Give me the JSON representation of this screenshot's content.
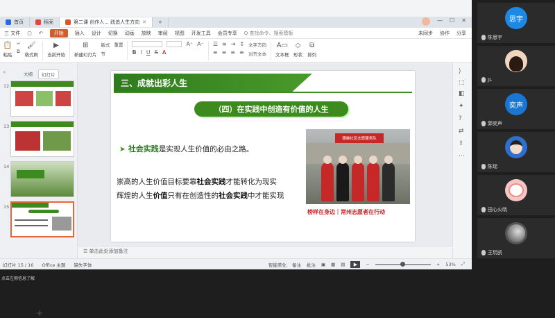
{
  "tabs": [
    {
      "label": "首页",
      "active": false
    },
    {
      "label": "稻壳",
      "active": false
    },
    {
      "label": "第二课 创作人... 践追人生方向",
      "active": true
    }
  ],
  "menu": {
    "items": [
      "三 文件",
      "开始",
      "插入",
      "设计",
      "切换",
      "动画",
      "放映",
      "审阅",
      "视图",
      "开发工具",
      "会员专享"
    ],
    "active": "开始",
    "search_placeholder": "Q 查找命令、搜索模板",
    "right": [
      "未同步",
      "协作",
      "分享"
    ]
  },
  "ribbon": {
    "paste": "粘贴",
    "format_painter": "格式刷",
    "from_current": "当前开始",
    "new_slide": "新建幻灯片",
    "layout": "版式",
    "section": "节",
    "reset": "重置",
    "textbox": "文本框",
    "shape": "形状",
    "arrange": "排列",
    "text_fill": "文字方向",
    "align_text": "对齐文本"
  },
  "left_panel": {
    "tabs": [
      "大纲",
      "幻灯片"
    ],
    "active_tab": "幻灯片",
    "slide_numbers": [
      "12",
      "13",
      "14",
      "15"
    ],
    "add_icon": "plus-icon"
  },
  "slide": {
    "header": "三、成就出彩人生",
    "subtitle": "（四）在实践中创造有价值的人生",
    "bullet_key": "社会实践",
    "bullet_rest": "是实现人生价值的必由之路。",
    "para1_a": "崇高的人生价值目标要靠",
    "para1_b": "社会实践",
    "para1_c": "才能转化为现实",
    "para2_a": "辉煌的人生",
    "para2_b": "价值",
    "para2_c": "只有在创造性的",
    "para2_d": "社会实践",
    "para2_e": "中才能实现",
    "photo_banner": "德雄社区志愿服务队",
    "photo_caption": "榜样在身边｜常州志愿者在行动"
  },
  "notes": {
    "placeholder": "单击此处添加备注"
  },
  "status": {
    "slide_count": "幻灯片 15 / 16",
    "theme": "Office 主题",
    "font_missing": "缺失字体",
    "smart_beautify": "智能美化",
    "notes_btn": "备注",
    "comments_btn": "批注",
    "zoom": "53%"
  },
  "taskbar": {
    "text": "点击左侧信息了解"
  },
  "participants": [
    {
      "name": "陈思宇",
      "avatar_text": "思宇",
      "color": "#1e88e5"
    },
    {
      "name": "JL",
      "avatar_text": "",
      "color": "#f0d5c0"
    },
    {
      "name": "郭奕声",
      "avatar_text": "奕声",
      "color": "#1976d2"
    },
    {
      "name": "陈瑶",
      "avatar_text": "",
      "color": "#2f6fcf"
    },
    {
      "name": "田心火晓",
      "avatar_text": "",
      "color": "#f4c6c6"
    },
    {
      "name": "王玥凯",
      "avatar_text": "",
      "color": "#555555"
    }
  ]
}
